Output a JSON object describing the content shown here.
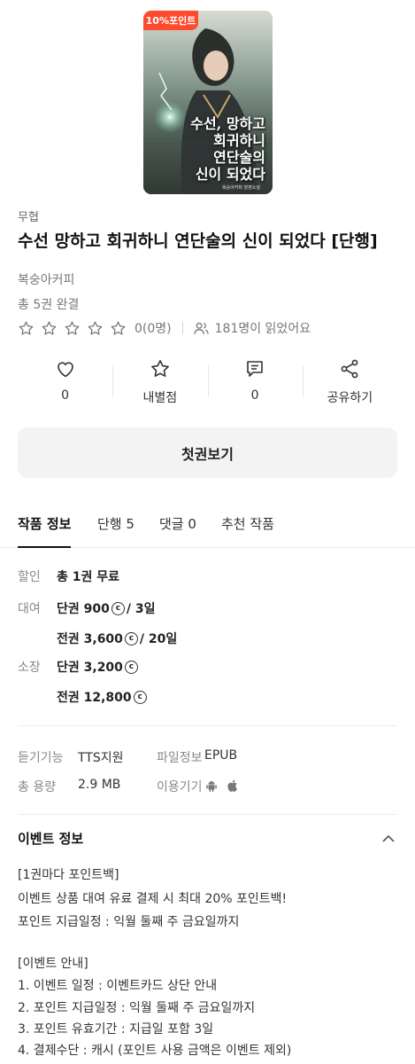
{
  "cover": {
    "badge": "10%포인트",
    "title_lines": [
      "수선, 망하고",
      "회귀하니",
      "연단술의",
      "신이 되었다"
    ],
    "subtitle": "복숭아커피 장편소설"
  },
  "book": {
    "genre": "무협",
    "title": "수선 망하고 회귀하니 연단술의 신이 되었다 [단행]",
    "author": "복숭아커피",
    "volumes": "총 5권 완결",
    "rating_text": "0(0명)",
    "readers_text": "181명이 읽었어요"
  },
  "actions": [
    {
      "icon": "heart-icon",
      "label": "0"
    },
    {
      "icon": "star-icon",
      "label": "내별점"
    },
    {
      "icon": "comment-icon",
      "label": "0"
    },
    {
      "icon": "share-icon",
      "label": "공유하기"
    }
  ],
  "primary_button": "첫권보기",
  "tabs": [
    "작품 정보",
    "단행 5",
    "댓글 0",
    "추천 작품"
  ],
  "pricing": {
    "discount_label": "할인",
    "discount_value": "총 1권 무료",
    "rental_label": "대여",
    "rental_single_a": "단권 900",
    "rental_single_b": "/ 3일",
    "rental_all_a": "전권 3,600",
    "rental_all_b": "/ 20일",
    "own_label": "소장",
    "own_single": "단권 3,200",
    "own_all": "전권 12,800",
    "coin_symbol": "c"
  },
  "meta": {
    "listen_label": "듣기기능",
    "listen_value": "TTS지원",
    "file_label": "파일정보",
    "file_value": "EPUB",
    "size_label": "총 용량",
    "size_value": "2.9 MB",
    "device_label": "이용기기",
    "device_icons": [
      "android-icon",
      "apple-icon"
    ]
  },
  "event": {
    "heading": "이벤트 정보",
    "lines": [
      "[1권마다 포인트백]",
      "이벤트 상품 대여 유료 결제 시 최대 20% 포인트백!",
      "포인트 지급일정 : 익월 둘째 주 금요일까지",
      "",
      "[이벤트 안내]",
      "1. 이벤트 일정 : 이벤트카드 상단 안내",
      "2. 포인트 지급일정 : 익월 둘째 주 금요일까지",
      "3. 포인트 유효기간 : 지급일 포함 3일",
      "4. 결제수단 : 캐시 (포인트 사용 금액은 이벤트 제외)"
    ]
  },
  "colors": {
    "badge": "#ff4a2d",
    "text": "#222222",
    "muted": "#888888",
    "button_bg": "#f3f3f3"
  }
}
